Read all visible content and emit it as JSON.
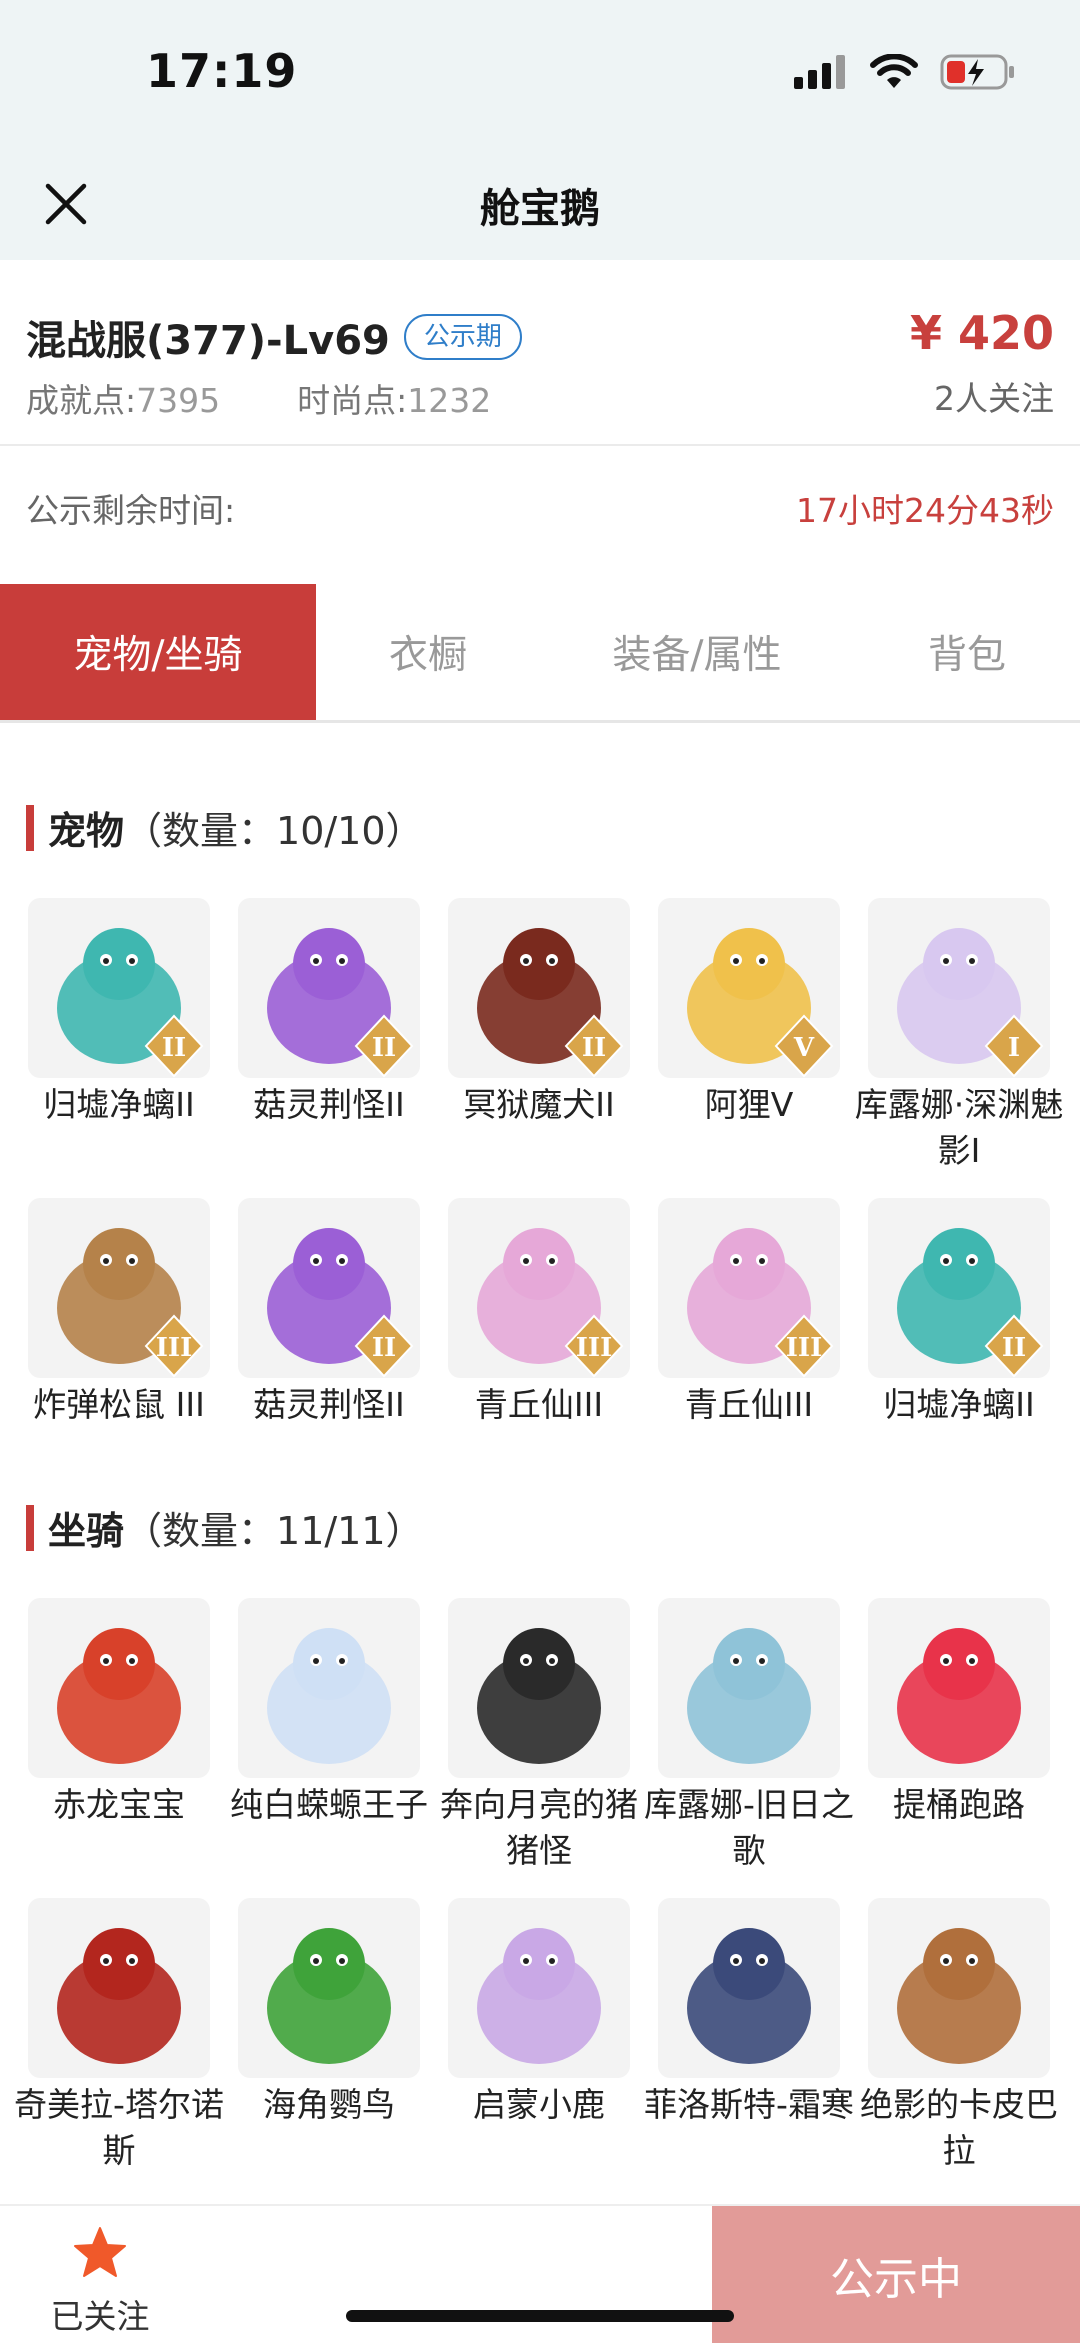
{
  "status_bar": {
    "time": "17:19"
  },
  "nav": {
    "title": "舱宝鹅"
  },
  "listing": {
    "server": "混战服(377)-Lv69",
    "badge": "公示期",
    "price": "¥ 420",
    "achievement_label": "成就点:",
    "achievement_value": "7395",
    "fashion_label": "时尚点:",
    "fashion_value": "1232",
    "followers": "2人关注"
  },
  "countdown": {
    "label": "公示剩余时间:",
    "value": "17小时24分43秒"
  },
  "tabs": [
    {
      "label": "宠物/坐骑",
      "active": true
    },
    {
      "label": "衣橱",
      "active": false
    },
    {
      "label": "装备/属性",
      "active": false
    },
    {
      "label": "背包",
      "active": false
    }
  ],
  "pets": {
    "title": "宠物",
    "count": "（数量：10/10）",
    "items": [
      {
        "name": "归墟净螭II",
        "badge": "II",
        "color": "#3fb7b0",
        "icon": "dragon-icon"
      },
      {
        "name": "菇灵荆怪II",
        "badge": "II",
        "color": "#9b5fd6",
        "icon": "mushroom-spirit-icon"
      },
      {
        "name": "冥狱魔犬II",
        "badge": "II",
        "color": "#7a2a1e",
        "icon": "hellhound-icon"
      },
      {
        "name": "阿狸V",
        "badge": "V",
        "color": "#f0c14b",
        "icon": "fox-icon"
      },
      {
        "name": "库露娜·深渊魅影I",
        "badge": "I",
        "color": "#d8c8f0",
        "icon": "siren-icon"
      },
      {
        "name": "炸弹松鼠 III",
        "badge": "III",
        "color": "#b5824a",
        "icon": "squirrel-icon"
      },
      {
        "name": "菇灵荆怪II",
        "badge": "II",
        "color": "#9b5fd6",
        "icon": "mushroom-spirit-icon"
      },
      {
        "name": "青丘仙III",
        "badge": "III",
        "color": "#e6a8d8",
        "icon": "fox-fairy-icon"
      },
      {
        "name": "青丘仙III",
        "badge": "III",
        "color": "#e6a8d8",
        "icon": "fox-fairy-icon"
      },
      {
        "name": "归墟净螭II",
        "badge": "II",
        "color": "#3fb7b0",
        "icon": "dragon-icon"
      }
    ]
  },
  "mounts": {
    "title": "坐骑",
    "count": "（数量：11/11）",
    "items": [
      {
        "name": "赤龙宝宝",
        "color": "#d8412a",
        "icon": "red-dragon-icon"
      },
      {
        "name": "纯白蝾螈王子",
        "color": "#cfe0f5",
        "icon": "axolotl-icon"
      },
      {
        "name": "奔向月亮的猪猪怪",
        "color": "#2a2a2a",
        "icon": "pig-icon"
      },
      {
        "name": "库露娜-旧日之歌",
        "color": "#8fc3d8",
        "icon": "siren-icon"
      },
      {
        "name": "提桶跑路",
        "color": "#e8334a",
        "icon": "bucket-icon"
      },
      {
        "name": "奇美拉-塔尔诺斯",
        "color": "#b3261e",
        "icon": "chimera-icon"
      },
      {
        "name": "海角鹦鸟",
        "color": "#3fa33a",
        "icon": "parrot-icon"
      },
      {
        "name": "启蒙小鹿",
        "color": "#c9a8e6",
        "icon": "deer-icon"
      },
      {
        "name": "菲洛斯特-霜寒",
        "color": "#3b4a7a",
        "icon": "frost-knight-icon"
      },
      {
        "name": "绝影的卡皮巴拉",
        "color": "#b06f3c",
        "icon": "capybara-icon"
      }
    ]
  },
  "bottom_bar": {
    "follow_label": "已关注",
    "status_button": "公示中"
  }
}
